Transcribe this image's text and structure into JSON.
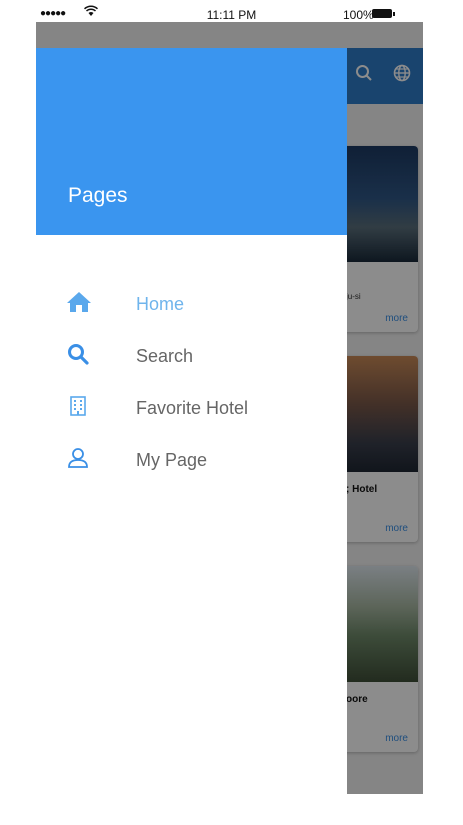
{
  "status_bar": {
    "signal": "●●●●●",
    "time": "11:11 PM",
    "battery": "100%"
  },
  "drawer": {
    "title": "Pages",
    "items": [
      {
        "label": "Home",
        "icon": "home-icon",
        "active": true
      },
      {
        "label": "Search",
        "icon": "search-icon",
        "active": false
      },
      {
        "label": "Favorite Hotel",
        "icon": "building-icon",
        "active": false
      },
      {
        "label": "My Page",
        "icon": "user-icon",
        "active": false
      }
    ]
  },
  "background": {
    "cards": [
      {
        "name": "",
        "sub": "ju-si",
        "more": "more"
      },
      {
        "name": "; Hotel",
        "sub": "",
        "more": "more"
      },
      {
        "name": "oore",
        "sub": "",
        "more": "more"
      }
    ]
  },
  "colors": {
    "accent": "#3a95ef",
    "header_bar": "#2e7cc9",
    "icon": "#5aa8ec"
  }
}
